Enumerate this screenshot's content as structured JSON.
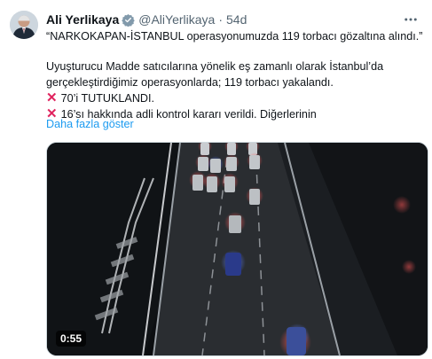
{
  "author": {
    "name": "Ali Yerlikaya",
    "handle": "@AliYerlikaya",
    "separator": "·",
    "time": "54d"
  },
  "tweet": {
    "line1": "“NARKOKAPAN-İSTANBUL operasyonumuzda 119 torbacı gözaltına alındı.”",
    "line2": "Uyuşturucu Madde satıcılarına yönelik eş zamanlı olarak İstanbul’da",
    "line3": "gerçekleştirdiğimiz operasyonlarda; 119 torbacı yakalandı.",
    "bullet1": "70’i TUTUKLANDI.",
    "bullet2": "16’sı hakkında adli kontrol kararı verildi. Diğerlerinin",
    "bullet_icon": "cross-mark-icon",
    "show_more": "Daha fazla göster"
  },
  "media": {
    "duration": "0:55"
  },
  "colors": {
    "link": "#1d9bf0",
    "verified": "#829aab",
    "cross": "#e0245e"
  }
}
